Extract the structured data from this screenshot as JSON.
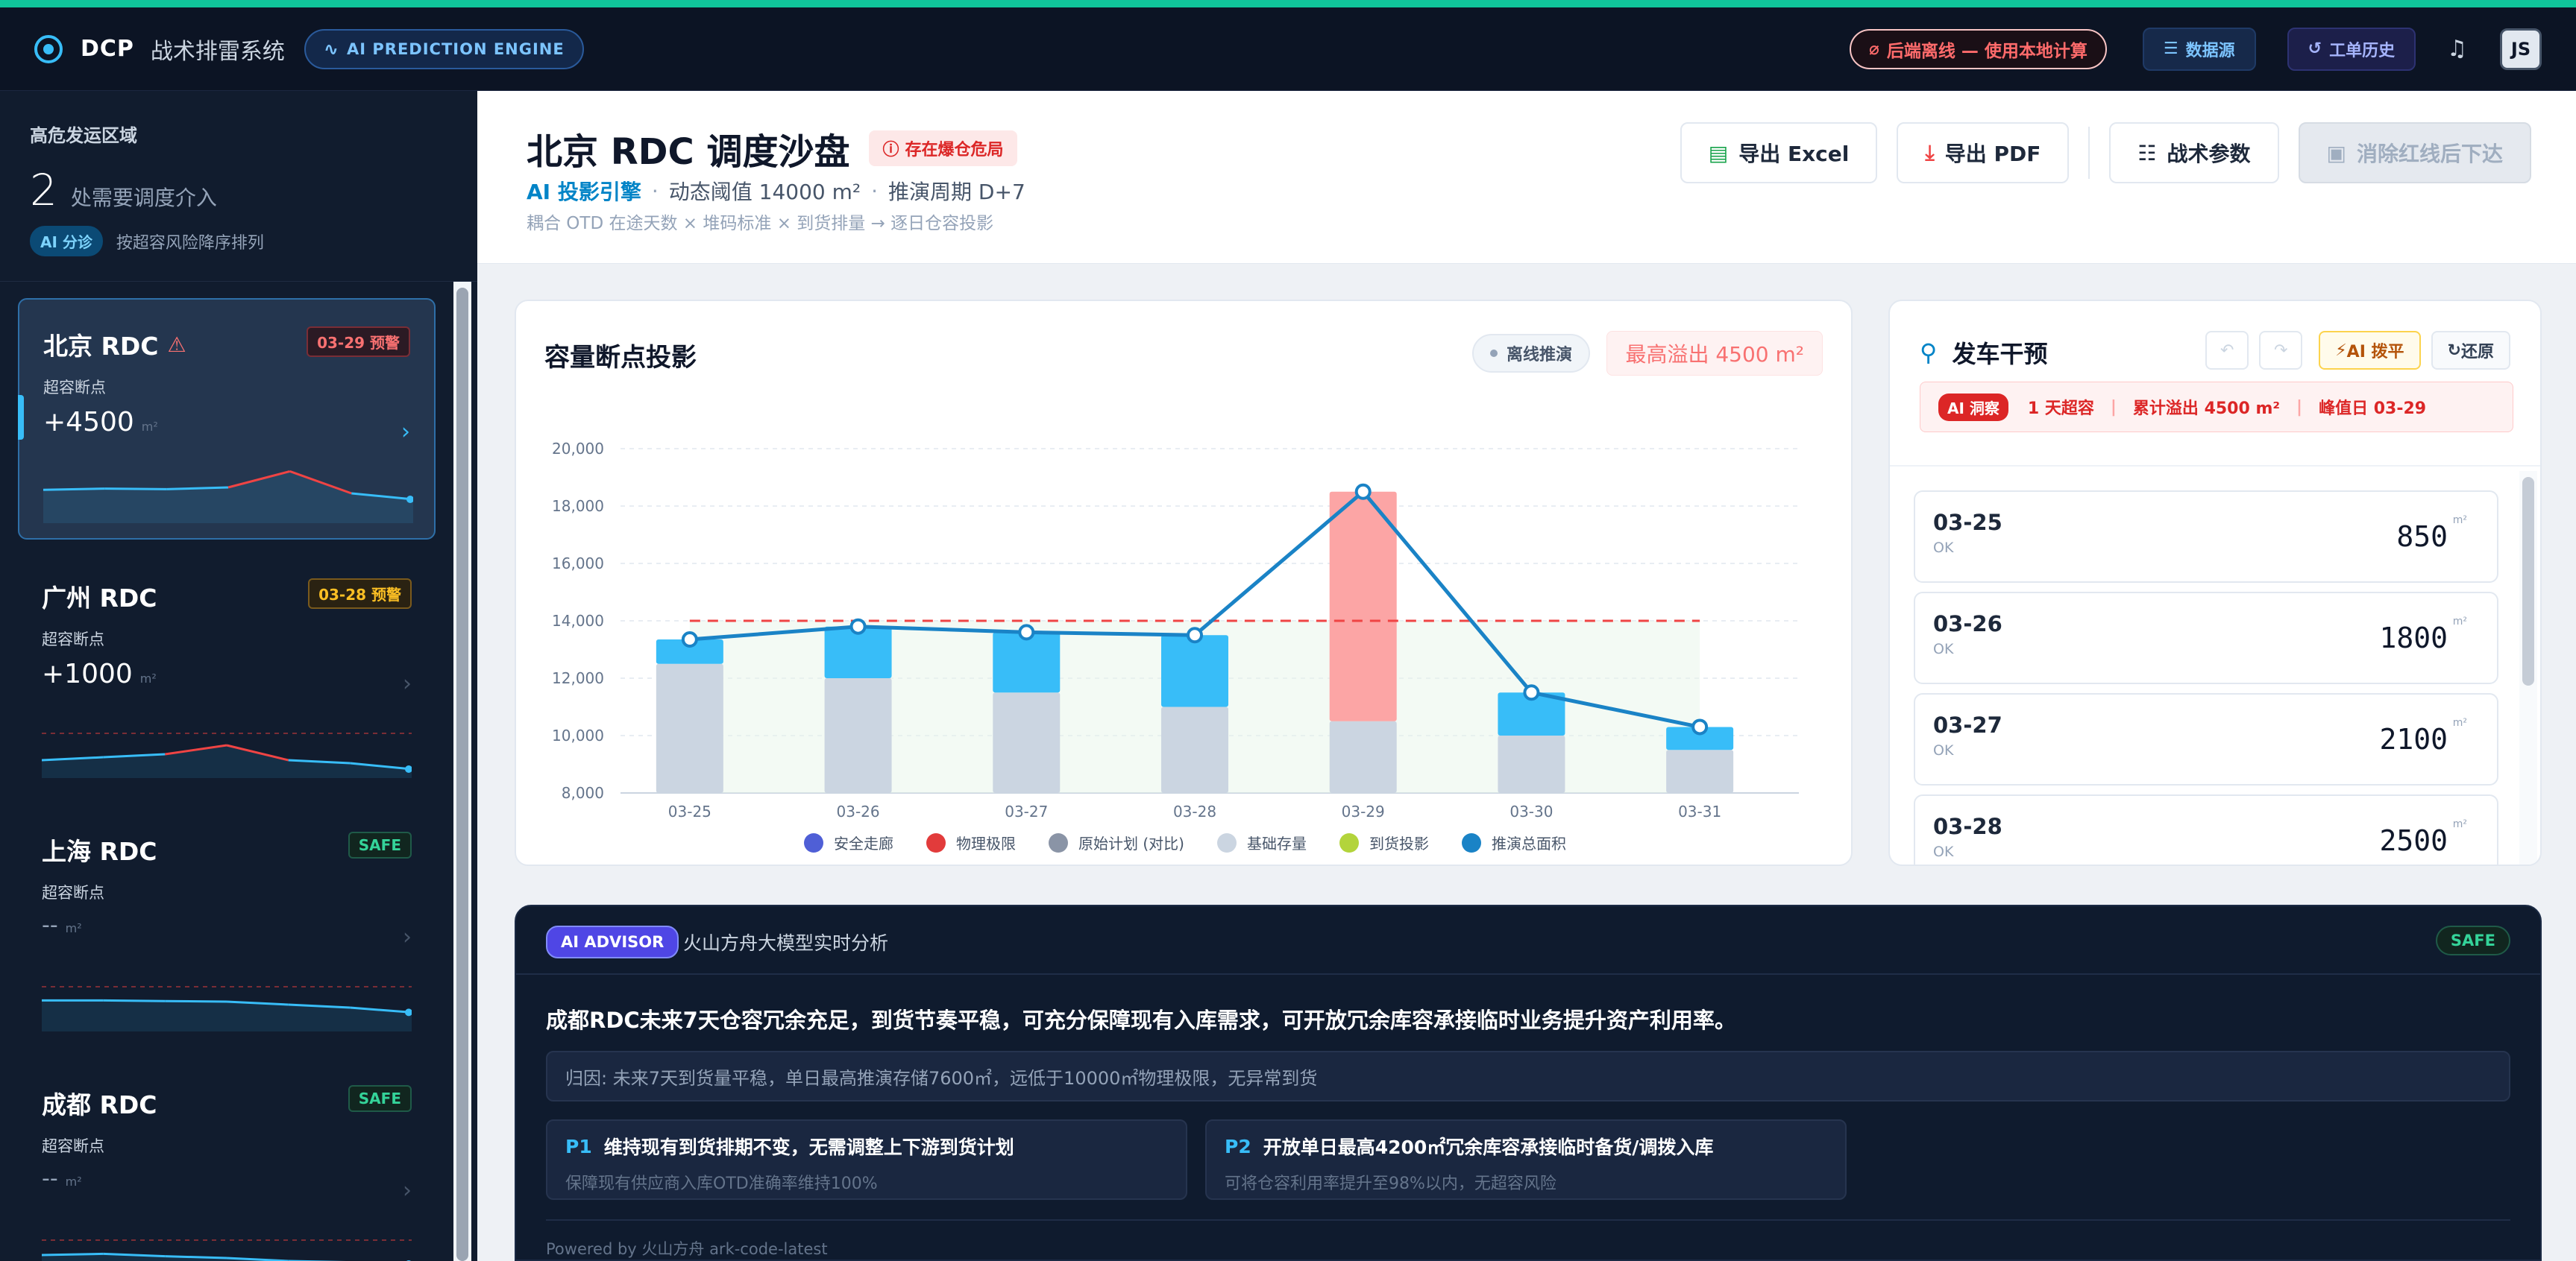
{
  "topbar": {
    "brand": "DCP",
    "system_name": "战术排雷系统",
    "engine_pill": "AI PREDICTION ENGINE",
    "offline_status": "后端离线 — 使用本地计算",
    "datasource_label": "数据源",
    "history_label": "工单历史",
    "avatar_initials": "JS"
  },
  "sidebar": {
    "header_label": "高危发运区域",
    "count": "2",
    "count_text": "处需要调度介入",
    "ai_tag": "AI 分诊",
    "sort_text": "按超容风险降序排列",
    "breakpoint_label": "超容断点",
    "unit": "m²",
    "rdcs": [
      {
        "name": "北京 RDC",
        "badge": "03-29 预警",
        "status": "red",
        "value": "+4500",
        "active": true,
        "warn": true,
        "spark": [
          0.56,
          0.58,
          0.57,
          0.6,
          0.87,
          0.5,
          0.4
        ]
      },
      {
        "name": "广州 RDC",
        "badge": "03-28 预警",
        "status": "amber",
        "value": "+1000",
        "active": false,
        "warn": false,
        "spark": [
          0.3,
          0.35,
          0.4,
          0.55,
          0.3,
          0.25,
          0.15
        ]
      },
      {
        "name": "上海 RDC",
        "badge": "SAFE",
        "status": "green",
        "value": "--",
        "active": false,
        "warn": false,
        "spark": [
          0.52,
          0.52,
          0.51,
          0.5,
          0.45,
          0.4,
          0.32
        ]
      },
      {
        "name": "成都 RDC",
        "badge": "SAFE",
        "status": "green",
        "value": "--",
        "active": false,
        "warn": false,
        "spark": [
          0.5,
          0.52,
          0.48,
          0.45,
          0.4,
          0.38,
          0.35
        ]
      }
    ]
  },
  "header": {
    "title": "北京 RDC 调度沙盘",
    "danger_pill": "存在爆仓危局",
    "ai_engine": "AI 投影引擎",
    "threshold": "动态阈值 14000 m²",
    "cycle": "推演周期 D+7",
    "formula": "耦合 OTD 在途天数 × 堆码标准 × 到货排量 → 逐日仓容投影",
    "export_excel": "导出 Excel",
    "export_pdf": "导出 PDF",
    "tactical_params": "战术参数",
    "dispatch": "消除红线后下达"
  },
  "chart_card": {
    "title": "容量断点投影",
    "offline_tag": "离线推演",
    "overflow_tag": "最高溢出 4500 m²",
    "legend": [
      {
        "label": "安全走廊",
        "color": "#4f5fd6"
      },
      {
        "label": "物理极限",
        "color": "#e23b3b"
      },
      {
        "label": "原始计划 (对比)",
        "color": "#8a94a6"
      },
      {
        "label": "基础存量",
        "color": "#cbd5e1"
      },
      {
        "label": "到货投影",
        "color": "#b3d43b"
      },
      {
        "label": "推演总面积",
        "color": "#1a83c6"
      }
    ]
  },
  "chart_data": {
    "type": "bar",
    "categories": [
      "03-25",
      "03-26",
      "03-27",
      "03-28",
      "03-29",
      "03-30",
      "03-31"
    ],
    "ylim": [
      8000,
      20000
    ],
    "yticks": [
      "8,000",
      "10,000",
      "12,000",
      "14,000",
      "16,000",
      "18,000",
      "20,000"
    ],
    "limit_value": 14000,
    "grid": true,
    "legend_position": "bottom",
    "series": [
      {
        "name": "基础存量",
        "values": [
          12500,
          12000,
          11500,
          11000,
          10500,
          10000,
          9500
        ],
        "color": "#cbd5e1"
      },
      {
        "name": "到货投影",
        "values": [
          850,
          1800,
          2100,
          2500,
          8000,
          1500,
          800
        ],
        "color": "#38bdf8",
        "overflow_color": "#fca5a5"
      },
      {
        "name": "推演总面积",
        "values": [
          13350,
          13800,
          13600,
          13500,
          18500,
          11500,
          10300
        ],
        "color": "#1a83c6"
      }
    ]
  },
  "intervention": {
    "title": "发车干预",
    "ai_level": "AI 拨平",
    "restore": "还原",
    "insight_tag": "AI 洞察",
    "insight_days": "1 天超容",
    "insight_total": "累计溢出 4500 m²",
    "insight_peak": "峰值日 03-29",
    "unit": "m²",
    "days": [
      {
        "date": "03-25",
        "status": "OK",
        "value": "850"
      },
      {
        "date": "03-26",
        "status": "OK",
        "value": "1800"
      },
      {
        "date": "03-27",
        "status": "OK",
        "value": "2100"
      },
      {
        "date": "03-28",
        "status": "OK",
        "value": "2500"
      }
    ]
  },
  "advisor": {
    "tag": "AI ADVISOR",
    "model": "火山方舟大模型实时分析",
    "status": "SAFE",
    "summary": "成都RDC未来7天仓容冗余充足，到货节奏平稳，可充分保障现有入库需求，可开放冗余库容承接临时业务提升资产利用率。",
    "cause": "归因: 未来7天到货量平稳，单日最高推演存储7600㎡，远低于10000㎡物理极限，无异常到货",
    "p1_tag": "P1",
    "p1_title": "维持现有到货排期不变，无需调整上下游到货计划",
    "p1_desc": "保障现有供应商入库OTD准确率维持100%",
    "p2_tag": "P2",
    "p2_title": "开放单日最高4200㎡冗余库容承接临时备货/调拨入库",
    "p2_desc": "可将仓容利用率提升至98%以内，无超容风险",
    "footer": "Powered by 火山方舟 ark-code-latest"
  }
}
